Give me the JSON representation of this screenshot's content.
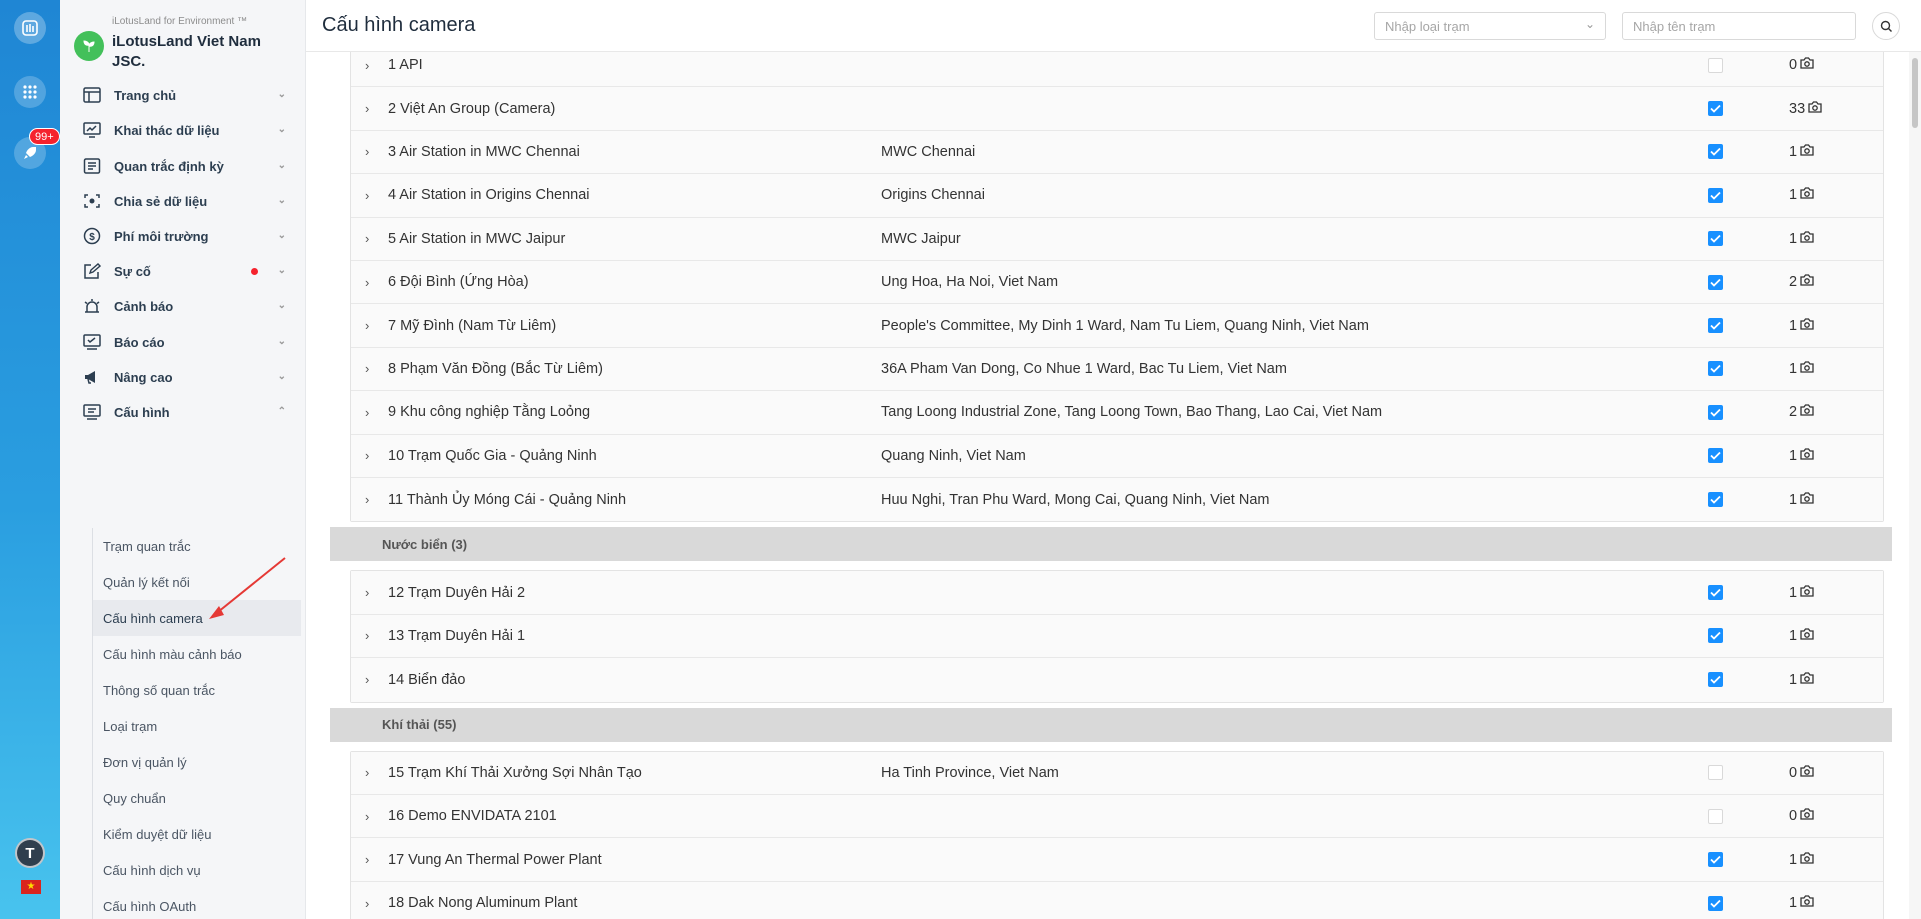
{
  "org": {
    "subtitle": "iLotusLand for Environment ™",
    "name": "iLotusLand Viet Nam JSC."
  },
  "rail": {
    "badge": "99+",
    "avatar": "T",
    "icons": [
      "app-logo-icon",
      "apps-grid-icon",
      "rocket-icon",
      "vn-flag-icon"
    ]
  },
  "menu": [
    {
      "label": "Trang chủ",
      "icon": "dashboard-icon"
    },
    {
      "label": "Khai thác dữ liệu",
      "icon": "monitor-chart-icon"
    },
    {
      "label": "Quan trắc định kỳ",
      "icon": "form-icon"
    },
    {
      "label": "Chia sẻ dữ liệu",
      "icon": "share-scan-icon"
    },
    {
      "label": "Phí môi trường",
      "icon": "dollar-icon"
    },
    {
      "label": "Sự cố",
      "icon": "edit-icon",
      "has_dot": true
    },
    {
      "label": "Cảnh báo",
      "icon": "alarm-icon"
    },
    {
      "label": "Báo cáo",
      "icon": "report-icon"
    },
    {
      "label": "Nâng cao",
      "icon": "megaphone-icon"
    },
    {
      "label": "Cấu hình",
      "icon": "config-icon",
      "expanded": true
    }
  ],
  "submenu": [
    {
      "label": "Trạm quan trắc"
    },
    {
      "label": "Quản lý kết nối"
    },
    {
      "label": "Cấu hình camera",
      "active": true
    },
    {
      "label": "Cấu hình màu cảnh báo"
    },
    {
      "label": "Thông số quan trắc"
    },
    {
      "label": "Loại trạm"
    },
    {
      "label": "Đơn vị quản lý"
    },
    {
      "label": "Quy chuẩn"
    },
    {
      "label": "Kiểm duyệt dữ liệu"
    },
    {
      "label": "Cấu hình dịch vụ"
    },
    {
      "label": "Cấu hình OAuth"
    }
  ],
  "header": {
    "title": "Cấu hình camera",
    "type_placeholder": "Nhập loại trạm",
    "name_placeholder": "Nhập tên trạm"
  },
  "groups": [
    {
      "rows": [
        {
          "name": "1 API",
          "address": "",
          "checked": false,
          "count": "0"
        },
        {
          "name": "2 Việt An Group (Camera)",
          "address": "",
          "checked": true,
          "count": "33"
        },
        {
          "name": "3 Air Station in MWC Chennai",
          "address": "MWC Chennai",
          "checked": true,
          "count": "1"
        },
        {
          "name": "4 Air Station in Origins Chennai",
          "address": "Origins Chennai",
          "checked": true,
          "count": "1"
        },
        {
          "name": "5 Air Station in MWC Jaipur",
          "address": "MWC Jaipur",
          "checked": true,
          "count": "1"
        },
        {
          "name": "6 Đội Bình (Ứng Hòa)",
          "address": "Ung Hoa, Ha Noi, Viet Nam",
          "checked": true,
          "count": "2"
        },
        {
          "name": "7 Mỹ Đình (Nam Từ Liêm)",
          "address": "People's Committee, My Dinh 1 Ward, Nam Tu Liem, Quang Ninh, Viet Nam",
          "checked": true,
          "count": "1"
        },
        {
          "name": "8 Phạm Văn Đồng (Bắc Từ Liêm)",
          "address": "36A Pham Van Dong, Co Nhue 1 Ward, Bac Tu Liem, Viet Nam",
          "checked": true,
          "count": "1"
        },
        {
          "name": "9 Khu công nghiệp Tằng Loỏng",
          "address": "Tang Loong Industrial Zone, Tang Loong Town, Bao Thang, Lao Cai, Viet Nam",
          "checked": true,
          "count": "2"
        },
        {
          "name": "10 Trạm Quốc Gia - Quảng Ninh",
          "address": "Quang Ninh, Viet Nam",
          "checked": true,
          "count": "1"
        },
        {
          "name": "11 Thành Ủy Móng Cái - Quảng Ninh",
          "address": "Huu Nghi, Tran Phu Ward, Mong Cai, Quang Ninh, Viet Nam",
          "checked": true,
          "count": "1"
        }
      ]
    },
    {
      "category": "Nước biển (3)",
      "rows": [
        {
          "name": "12 Trạm Duyên Hải 2",
          "address": "",
          "checked": true,
          "count": "1"
        },
        {
          "name": "13 Trạm Duyên Hải 1",
          "address": "",
          "checked": true,
          "count": "1"
        },
        {
          "name": "14 Biển đảo",
          "address": "",
          "checked": true,
          "count": "1"
        }
      ]
    },
    {
      "category": "Khí thải (55)",
      "rows": [
        {
          "name": "15 Trạm Khí Thải Xưởng Sợi Nhân Tạo",
          "address": "Ha Tinh Province, Viet Nam",
          "checked": false,
          "count": "0"
        },
        {
          "name": "16 Demo ENVIDATA 2101",
          "address": "",
          "checked": false,
          "count": "0"
        },
        {
          "name": "17 Vung An Thermal Power Plant",
          "address": "",
          "checked": true,
          "count": "1"
        },
        {
          "name": "18 Dak Nong Aluminum Plant",
          "address": "",
          "checked": true,
          "count": "1"
        }
      ]
    }
  ],
  "colors": {
    "accent": "#1890ff",
    "rail_top": "#1f86d4",
    "rail_bottom": "#48c3ee",
    "badge": "#f5222d",
    "annotation_arrow": "#e53935"
  }
}
